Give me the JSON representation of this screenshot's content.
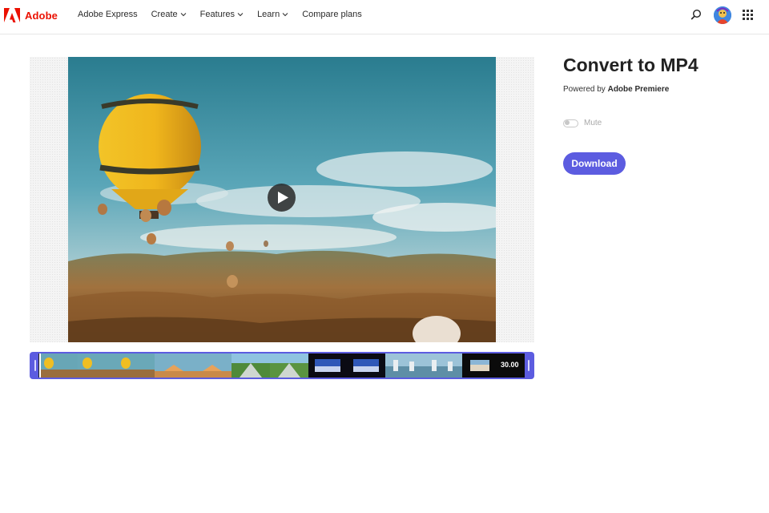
{
  "header": {
    "brand": "Adobe",
    "nav": [
      {
        "label": "Adobe Express",
        "has_menu": false
      },
      {
        "label": "Create",
        "has_menu": true
      },
      {
        "label": "Features",
        "has_menu": true
      },
      {
        "label": "Learn",
        "has_menu": true
      },
      {
        "label": "Compare plans",
        "has_menu": false
      }
    ],
    "icons": [
      "search-icon",
      "avatar",
      "app-grid-icon"
    ]
  },
  "preview": {
    "play_icon": "play-icon"
  },
  "timeline": {
    "duration": "30.00",
    "accent": "#5c5ce0"
  },
  "panel": {
    "title": "Convert to MP4",
    "powered_prefix": "Powered by ",
    "powered_product": "Adobe Premiere",
    "mute_label": "Mute",
    "mute_on": false,
    "download_label": "Download"
  },
  "colors": {
    "brand_red": "#eb1000",
    "accent": "#5c5ce0"
  }
}
